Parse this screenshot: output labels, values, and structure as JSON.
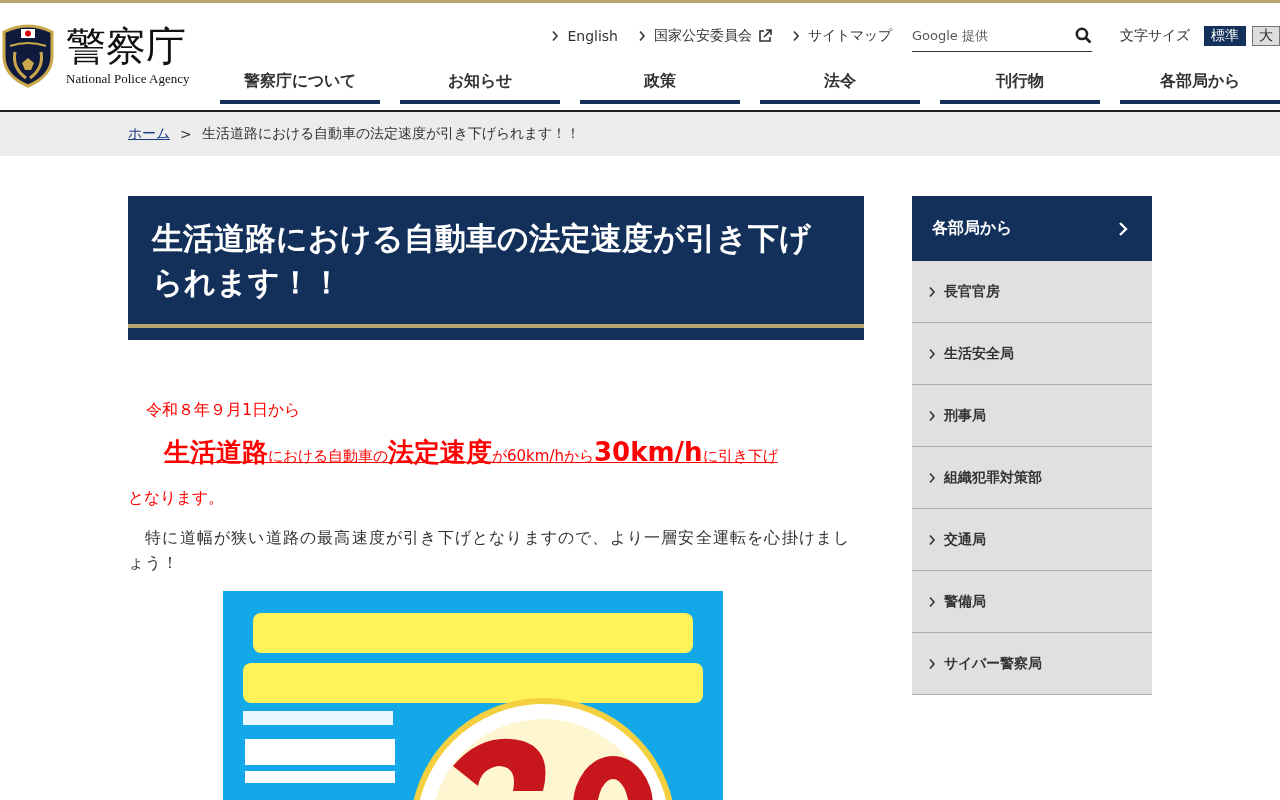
{
  "header": {
    "logo_title": "警察庁",
    "logo_subtitle": "National Police Agency",
    "utility_links": [
      {
        "label": "English",
        "external": false
      },
      {
        "label": "国家公安委員会",
        "external": true
      },
      {
        "label": "サイトマップ",
        "external": false
      }
    ],
    "search": {
      "placeholder": "Google 提供"
    },
    "text_size": {
      "label": "文字サイズ",
      "options": [
        {
          "label": "標準",
          "selected": true
        },
        {
          "label": "大",
          "selected": false
        }
      ]
    },
    "nav": [
      {
        "label": "警察庁について"
      },
      {
        "label": "お知らせ"
      },
      {
        "label": "政策"
      },
      {
        "label": "法令"
      },
      {
        "label": "刊行物"
      },
      {
        "label": "各部局から"
      }
    ]
  },
  "breadcrumb": {
    "home": "ホーム",
    "separator": ">",
    "current": "生活道路における自動車の法定速度が引き下げられます！！"
  },
  "article": {
    "title": "生活道路における自動車の法定速度が引き下げられます！！",
    "date_line": "令和８年９月1日から",
    "headline": [
      {
        "text": "生活道路",
        "emphasis": true
      },
      {
        "text": "における自動車の",
        "emphasis": false
      },
      {
        "text": "法定速度",
        "emphasis": true
      },
      {
        "text": "が60km/hから",
        "emphasis": false
      },
      {
        "text": "30km/h",
        "emphasis": true
      },
      {
        "text": "に引き下げ",
        "emphasis": false
      }
    ],
    "headline_end": "となります。",
    "body": "　特に道幅が狭い道路の最高速度が引き下げとなりますので、より一層安全運転を心掛けましょう！"
  },
  "sidebar": {
    "title": "各部局から",
    "items": [
      {
        "label": "長官官房"
      },
      {
        "label": "生活安全局"
      },
      {
        "label": "刑事局"
      },
      {
        "label": "組織犯罪対策部"
      },
      {
        "label": "交通局"
      },
      {
        "label": "警備局"
      },
      {
        "label": "サイバー警察局"
      }
    ]
  }
}
